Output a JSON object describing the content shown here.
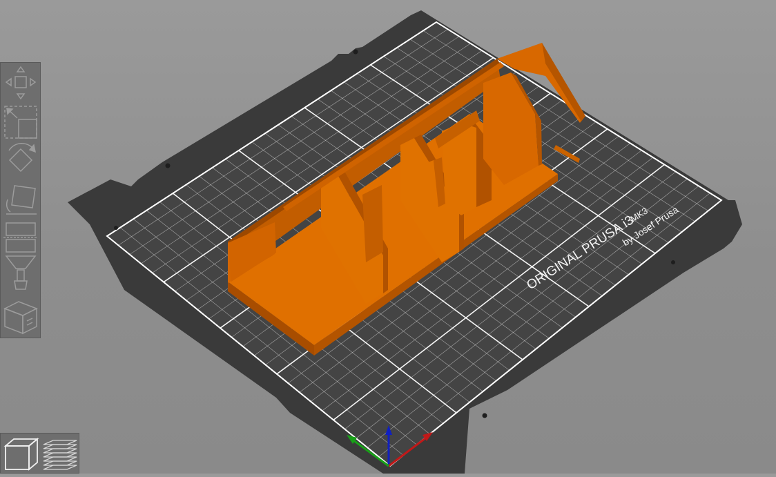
{
  "bed": {
    "brand_line": "ORIGINAL PRUSA i3",
    "model": "MK3",
    "byline": "by Josef Prusa"
  },
  "colors": {
    "background": "#8e8e8e",
    "bed_plate": "#3a3a3a",
    "grid_line": "#ffffff",
    "model_orange": "#dd6a00",
    "axis_x": "#c01818",
    "axis_y": "#18a018",
    "axis_z": "#1020c0"
  },
  "toolbar": {
    "tools": [
      {
        "icon": "move-icon"
      },
      {
        "icon": "scale-icon"
      },
      {
        "icon": "rotate-icon"
      },
      {
        "icon": "place-on-face-icon"
      },
      {
        "icon": "cut-icon"
      },
      {
        "icon": "support-paint-icon"
      },
      {
        "icon": "hollow-icon"
      }
    ]
  },
  "view_switch": {
    "buttons": [
      {
        "icon": "3d-view-icon"
      },
      {
        "icon": "preview-layers-icon"
      }
    ]
  }
}
